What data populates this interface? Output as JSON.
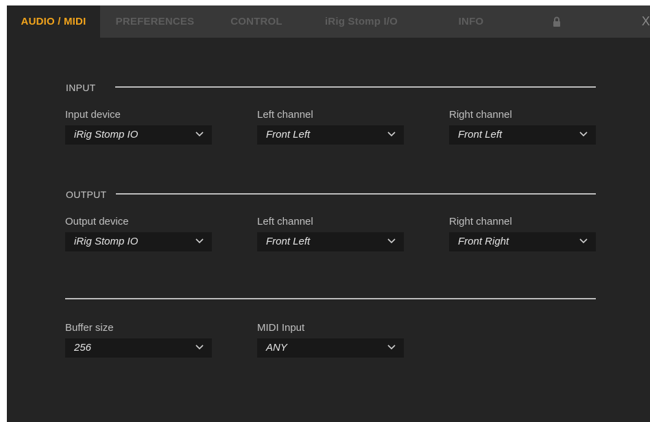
{
  "tabs": [
    {
      "label": "AUDIO / MIDI",
      "active": true
    },
    {
      "label": "PREFERENCES"
    },
    {
      "label": "CONTROL"
    },
    {
      "label": "iRig Stomp I/O"
    },
    {
      "label": "INFO"
    }
  ],
  "lock_icon": "lock-icon",
  "close_label": "X",
  "accent_color": "#f2a41c",
  "input": {
    "section_label": "INPUT",
    "device": {
      "label": "Input device",
      "value": "iRig Stomp IO"
    },
    "left": {
      "label": "Left channel",
      "value": "Front Left"
    },
    "right": {
      "label": "Right channel",
      "value": "Front Left"
    }
  },
  "output": {
    "section_label": "OUTPUT",
    "device": {
      "label": "Output device",
      "value": "iRig Stomp IO"
    },
    "left": {
      "label": "Left channel",
      "value": "Front Left"
    },
    "right": {
      "label": "Right channel",
      "value": "Front Right"
    }
  },
  "general": {
    "buffer": {
      "label": "Buffer size",
      "value": "256"
    },
    "midi": {
      "label": "MIDI Input",
      "value": "ANY"
    }
  }
}
